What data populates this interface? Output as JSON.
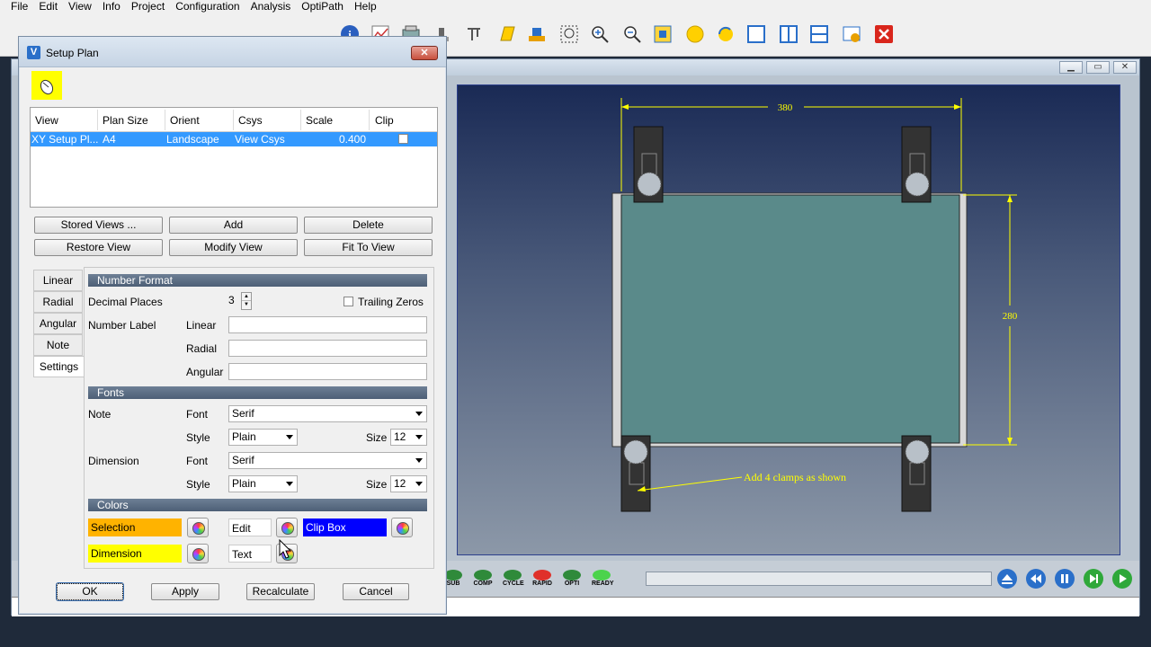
{
  "menu": [
    "File",
    "Edit",
    "View",
    "Info",
    "Project",
    "Configuration",
    "Analysis",
    "OptiPath",
    "Help"
  ],
  "toolbar_icons": [
    "vc-icon",
    "vc-icon",
    "ip-icon",
    "ip-icon",
    "tool-icon",
    "folder-icon",
    "page-icon",
    "checklist-icon",
    "search-icon",
    "info-icon",
    "chart-icon",
    "machine-icon",
    "fixture-icon",
    "note-icon",
    "measure-icon",
    "zoom-box-icon",
    "zoom-in-icon",
    "zoom-out-icon",
    "fit-icon",
    "sphere-icon",
    "rotate-icon",
    "single-view-icon",
    "split-vertical-icon",
    "split-horizontal-icon",
    "settings-icon",
    "close-icon"
  ],
  "dialog": {
    "title": "Setup Plan",
    "close": "✕"
  },
  "table": {
    "headers": [
      "View",
      "Plan Size",
      "Orient",
      "Csys",
      "Scale",
      "Clip"
    ],
    "row": {
      "view": "XY Setup Pl...",
      "plan_size": "A4",
      "orient": "Landscape",
      "csys": "View Csys",
      "scale": "0.400"
    }
  },
  "buttons": {
    "stored_views": "Stored Views ...",
    "add": "Add",
    "delete": "Delete",
    "restore_view": "Restore View",
    "modify_view": "Modify View",
    "fit_to_view": "Fit To View",
    "ok": "OK",
    "apply": "Apply",
    "recalculate": "Recalculate",
    "cancel": "Cancel"
  },
  "tabs": [
    "Linear",
    "Radial",
    "Angular",
    "Note",
    "Settings"
  ],
  "settings": {
    "number_format": "Number Format",
    "decimal_places_label": "Decimal Places",
    "decimal_places": "3",
    "trailing_zeros": "Trailing Zeros",
    "number_label": "Number Label",
    "linear": "Linear",
    "radial": "Radial",
    "angular": "Angular",
    "fonts": "Fonts",
    "note": "Note",
    "font_label": "Font",
    "style_label": "Style",
    "size_label": "Size",
    "note_font": "Serif",
    "note_style": "Plain",
    "note_size": "12",
    "dimension": "Dimension",
    "dim_font": "Serif",
    "dim_style": "Plain",
    "dim_size": "12",
    "colors": "Colors",
    "selection": "Selection",
    "edit": "Edit",
    "clip_box": "Clip Box",
    "dimension_color": "Dimension",
    "text": "Text"
  },
  "viewport": {
    "dim_top": "380",
    "dim_right": "280",
    "annotation": "Add 4 clamps as shown"
  },
  "status": [
    "SUB",
    "COMP",
    "CYCLE",
    "RAPID",
    "OPTI",
    "READY"
  ],
  "colors": {
    "selection": "#ffb300",
    "dimension": "#ffff00",
    "clip_box": "#0000ff",
    "plate": "#5a8a8a"
  }
}
